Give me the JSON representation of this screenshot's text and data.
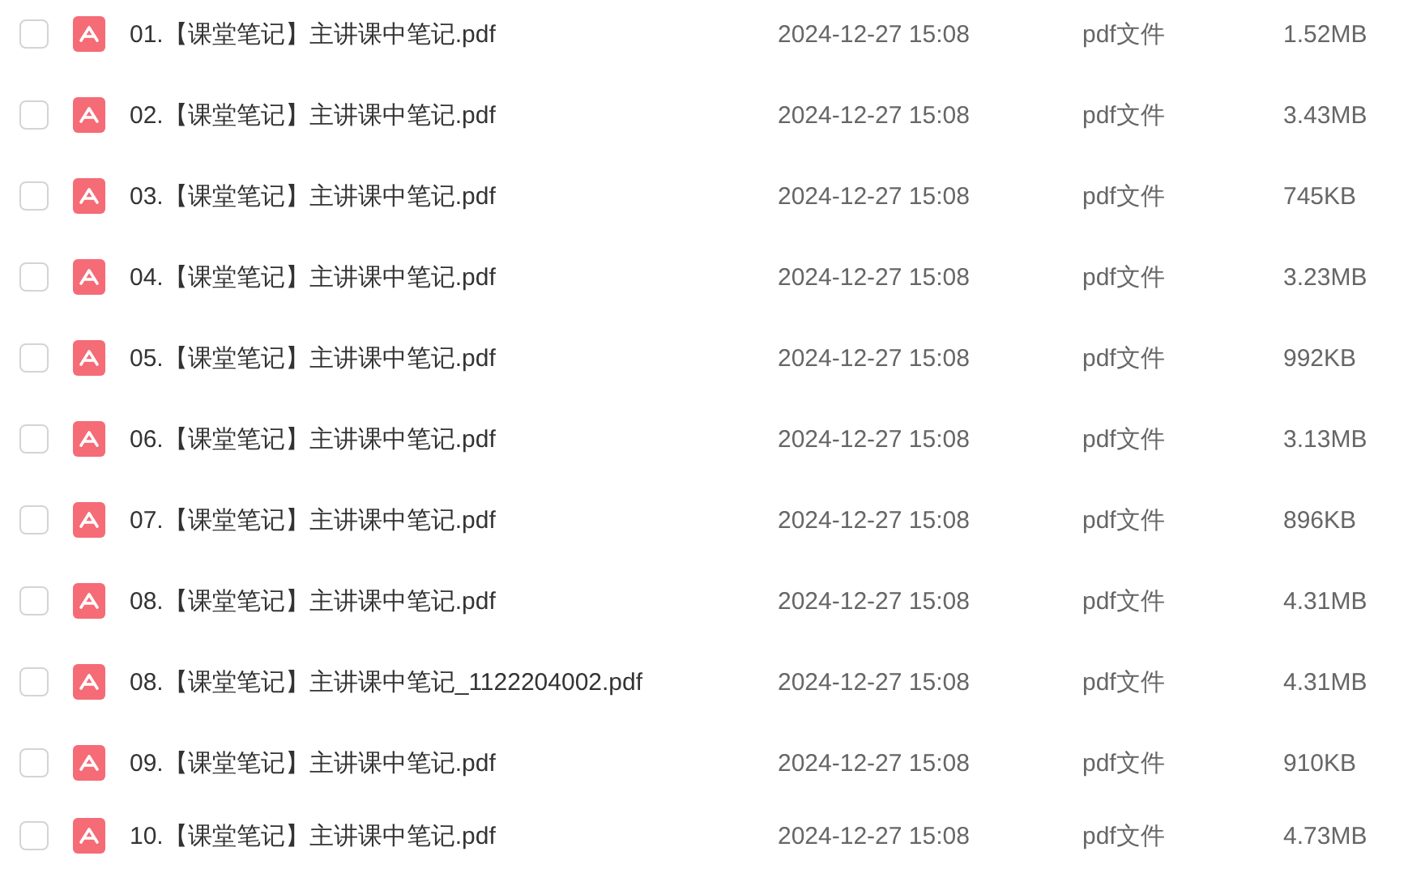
{
  "files": [
    {
      "checked": false,
      "name": "01.【课堂笔记】主讲课中笔记.pdf",
      "date": "2024-12-27 15:08",
      "type": "pdf文件",
      "size": "1.52MB"
    },
    {
      "checked": false,
      "name": "02.【课堂笔记】主讲课中笔记.pdf",
      "date": "2024-12-27 15:08",
      "type": "pdf文件",
      "size": "3.43MB"
    },
    {
      "checked": false,
      "name": "03.【课堂笔记】主讲课中笔记.pdf",
      "date": "2024-12-27 15:08",
      "type": "pdf文件",
      "size": "745KB"
    },
    {
      "checked": false,
      "name": "04.【课堂笔记】主讲课中笔记.pdf",
      "date": "2024-12-27 15:08",
      "type": "pdf文件",
      "size": "3.23MB"
    },
    {
      "checked": false,
      "name": "05.【课堂笔记】主讲课中笔记.pdf",
      "date": "2024-12-27 15:08",
      "type": "pdf文件",
      "size": "992KB"
    },
    {
      "checked": false,
      "name": "06.【课堂笔记】主讲课中笔记.pdf",
      "date": "2024-12-27 15:08",
      "type": "pdf文件",
      "size": "3.13MB"
    },
    {
      "checked": false,
      "name": "07.【课堂笔记】主讲课中笔记.pdf",
      "date": "2024-12-27 15:08",
      "type": "pdf文件",
      "size": "896KB"
    },
    {
      "checked": false,
      "name": "08.【课堂笔记】主讲课中笔记.pdf",
      "date": "2024-12-27 15:08",
      "type": "pdf文件",
      "size": "4.31MB"
    },
    {
      "checked": false,
      "name": "08.【课堂笔记】主讲课中笔记_1122204002.pdf",
      "date": "2024-12-27 15:08",
      "type": "pdf文件",
      "size": "4.31MB"
    },
    {
      "checked": false,
      "name": "09.【课堂笔记】主讲课中笔记.pdf",
      "date": "2024-12-27 15:08",
      "type": "pdf文件",
      "size": "910KB"
    },
    {
      "checked": false,
      "name": "10.【课堂笔记】主讲课中笔记.pdf",
      "date": "2024-12-27 15:08",
      "type": "pdf文件",
      "size": "4.73MB"
    }
  ]
}
